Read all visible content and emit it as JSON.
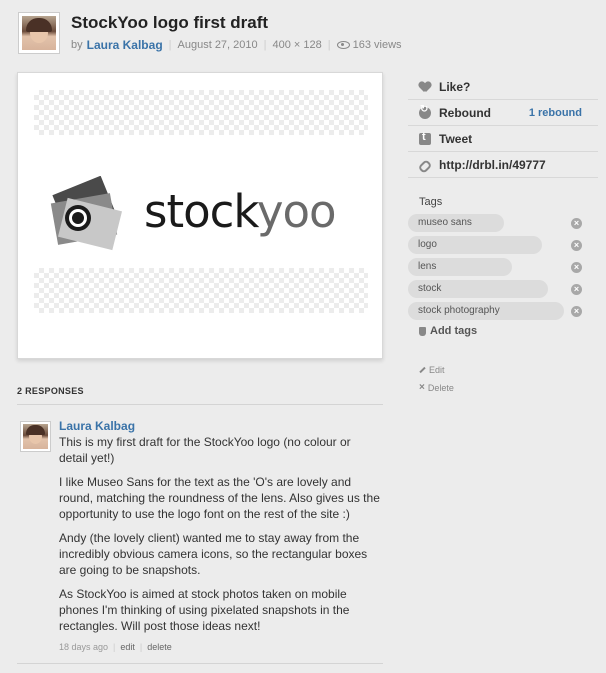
{
  "shot": {
    "title": "StockYoo logo first draft",
    "by_label": "by",
    "author": "Laura Kalbag",
    "date": "August 27, 2010",
    "dimensions": "400 × 128",
    "views": "163 views",
    "logo_text_stock": "stock",
    "logo_text_yoo": "yoo"
  },
  "sidebar": {
    "like_label": "Like?",
    "rebound_label": "Rebound",
    "rebound_count": "1 rebound",
    "tweet_label": "Tweet",
    "short_url": "http://drbl.in/49777",
    "tags_label": "Tags",
    "tags": [
      "museo sans",
      "logo",
      "lens",
      "stock",
      "stock photography"
    ],
    "add_tags_label": "Add tags",
    "edit_label": "Edit",
    "delete_label": "Delete"
  },
  "responses": {
    "header": "2 RESPONSES",
    "comments": [
      {
        "author": "Laura Kalbag",
        "paragraphs": [
          "This is my first draft for the StockYoo logo (no colour or detail yet!)",
          "I like Museo Sans for the text as the 'O's are lovely and round, matching the roundness of the lens. Also gives us the opportunity to use the logo font on the rest of the site :)",
          "Andy (the lovely client) wanted me to stay away from the incredibly obvious camera icons, so the rectangular boxes are going to be snapshots.",
          "As StockYoo is aimed at stock photos taken on mobile phones I'm thinking of using pixelated snapshots in the rectangles. Will post those ideas next!"
        ],
        "time": "18 days ago",
        "edit_label": "edit",
        "delete_label": "delete"
      }
    ]
  },
  "colors": {
    "link": "#3a73a8",
    "background": "#ececec",
    "tag_pill": "#dcdcdc"
  }
}
